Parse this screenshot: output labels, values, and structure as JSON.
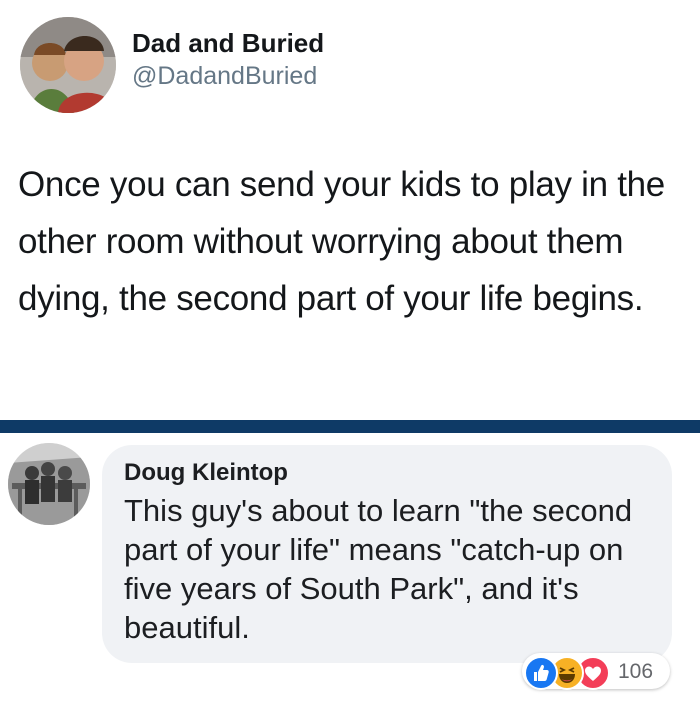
{
  "tweet": {
    "display_name": "Dad and Buried",
    "handle": "@DadandBuried",
    "text": "Once you can send your kids to play in the other room without worrying about them dying, the second part of your life begins.",
    "avatar_icon": "profile-photo-icon"
  },
  "comment": {
    "author": "Doug Kleintop",
    "text": "This guy's about to learn \"the second part of your life\" means \"catch-up on five years of South Park\", and it's beautiful.",
    "avatar_icon": "profile-photo-icon",
    "reactions": {
      "icons": [
        "like-icon",
        "haha-icon",
        "love-icon"
      ],
      "count": "106"
    }
  },
  "colors": {
    "divider": "#0e3a66",
    "bubble": "#f0f2f5",
    "handle": "#657786",
    "like": "#1877f2",
    "haha": "#f7b125",
    "love": "#f33e58"
  }
}
